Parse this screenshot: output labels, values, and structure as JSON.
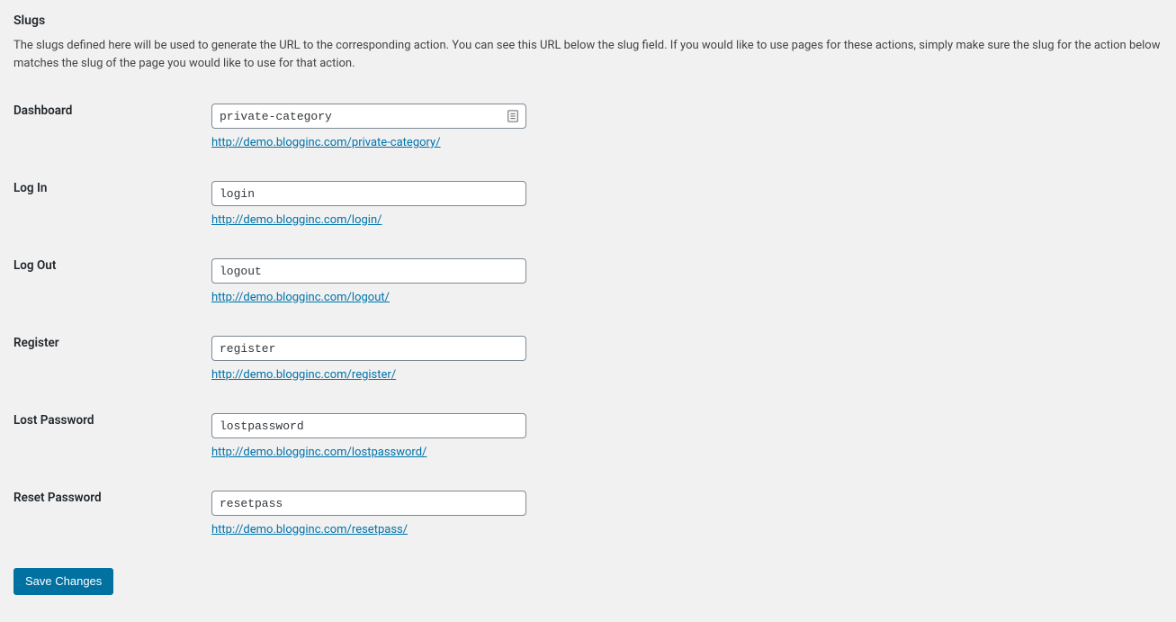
{
  "heading": "Slugs",
  "description": "The slugs defined here will be used to generate the URL to the corresponding action. You can see this URL below the slug field. If you would like to use pages for these actions, simply make sure the slug for the action below matches the slug of the page you would like to use for that action.",
  "fields": {
    "dashboard": {
      "label": "Dashboard",
      "value": "private-category",
      "url": "http://demo.blogginc.com/private-category/"
    },
    "login": {
      "label": "Log In",
      "value": "login",
      "url": "http://demo.blogginc.com/login/"
    },
    "logout": {
      "label": "Log Out",
      "value": "logout",
      "url": "http://demo.blogginc.com/logout/"
    },
    "register": {
      "label": "Register",
      "value": "register",
      "url": "http://demo.blogginc.com/register/"
    },
    "lostpassword": {
      "label": "Lost Password",
      "value": "lostpassword",
      "url": "http://demo.blogginc.com/lostpassword/"
    },
    "resetpass": {
      "label": "Reset Password",
      "value": "resetpass",
      "url": "http://demo.blogginc.com/resetpass/"
    }
  },
  "save_button": "Save Changes"
}
